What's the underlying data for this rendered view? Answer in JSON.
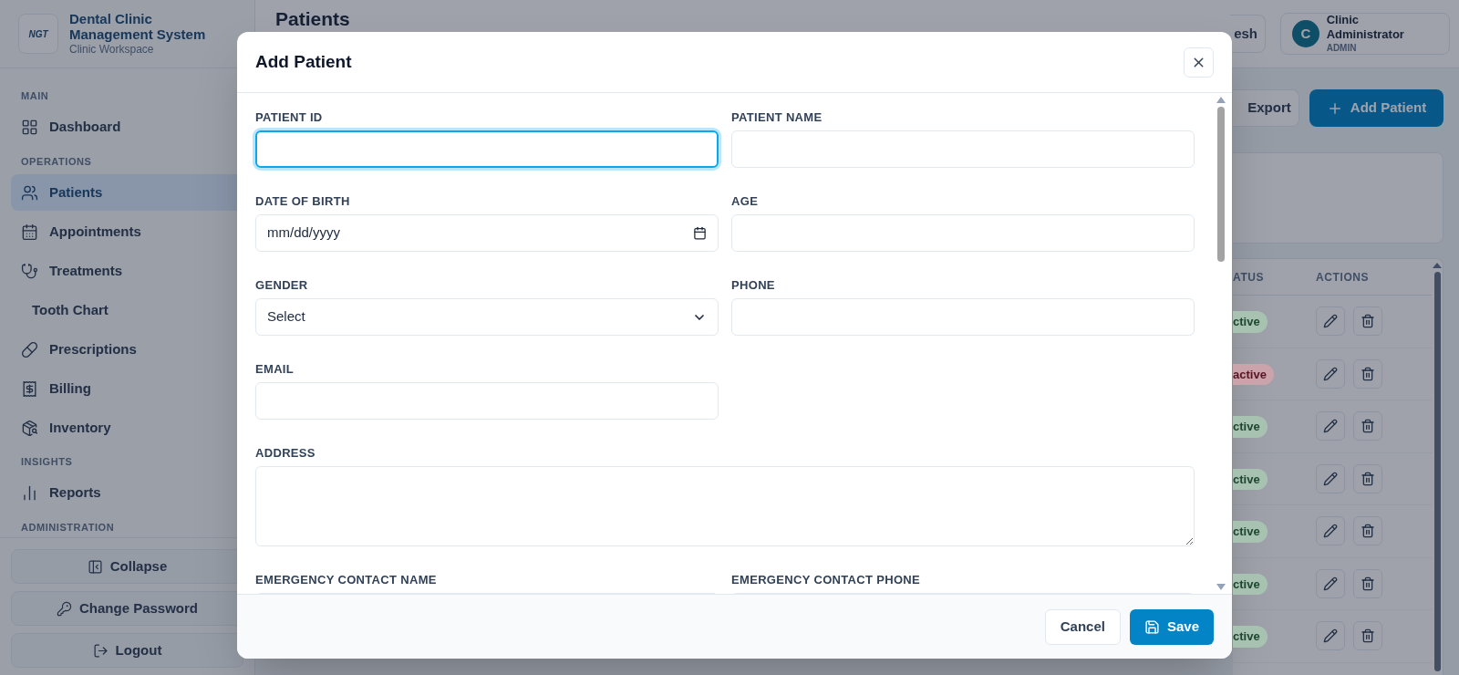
{
  "sidebar": {
    "logo_text": "NGT",
    "title": "Dental Clinic Management System",
    "subtitle": "Clinic Workspace",
    "sections": [
      {
        "heading": "MAIN",
        "items": [
          {
            "label": "Dashboard",
            "selected": false
          }
        ]
      },
      {
        "heading": "OPERATIONS",
        "items": [
          {
            "label": "Patients",
            "selected": true
          },
          {
            "label": "Appointments",
            "selected": false
          },
          {
            "label": "Treatments",
            "selected": false
          },
          {
            "label": "Tooth Chart",
            "selected": false
          },
          {
            "label": "Prescriptions",
            "selected": false
          },
          {
            "label": "Billing",
            "selected": false
          },
          {
            "label": "Inventory",
            "selected": false
          }
        ]
      },
      {
        "heading": "INSIGHTS",
        "items": [
          {
            "label": "Reports",
            "selected": false
          }
        ]
      },
      {
        "heading": "ADMINISTRATION"
      }
    ],
    "footer_buttons": [
      "Collapse",
      "Change Password",
      "Logout"
    ]
  },
  "header": {
    "title": "Patients",
    "refresh_fragment": "esh",
    "user": {
      "initial": "C",
      "name": "Clinic Administrator",
      "role": "ADMIN"
    }
  },
  "toolbar": {
    "export": "Export",
    "add": "Add Patient"
  },
  "table": {
    "columns": [
      "ATUS",
      "ACTIONS"
    ],
    "rows": [
      {
        "status": "ctive",
        "color": "#a8c2b2"
      },
      {
        "status": "active",
        "color": "#cba3ab"
      },
      {
        "status": "ctive",
        "color": "#a8c2b2"
      },
      {
        "status": "ctive",
        "color": "#a8c2b2"
      },
      {
        "status": "ctive",
        "color": "#a8c2b2"
      },
      {
        "status": "ctive",
        "color": "#a8c2b2"
      },
      {
        "status": "ctive",
        "color": "#a8c2b2"
      }
    ]
  },
  "modal": {
    "title": "Add Patient",
    "fields": [
      {
        "label": "PATIENT ID",
        "kind": "text",
        "focused": true
      },
      {
        "label": "PATIENT NAME",
        "kind": "text",
        "focused": false
      },
      {
        "label": "DATE OF BIRTH",
        "kind": "date",
        "placeholder": "mm/dd/yyyy",
        "focused": false
      },
      {
        "label": "AGE",
        "kind": "text",
        "focused": false
      },
      {
        "label": "GENDER",
        "kind": "select",
        "value": "Select",
        "focused": false
      },
      {
        "label": "PHONE",
        "kind": "text",
        "focused": false
      },
      {
        "label": "EMAIL",
        "kind": "text",
        "focused": false
      },
      {
        "label": "ADDRESS",
        "kind": "textarea",
        "focused": false
      },
      {
        "label": "EMERGENCY CONTACT NAME",
        "kind": "text",
        "focused": false
      },
      {
        "label": "EMERGENCY CONTACT PHONE",
        "kind": "text",
        "focused": false
      }
    ],
    "cancel": "Cancel",
    "save": "Save"
  }
}
